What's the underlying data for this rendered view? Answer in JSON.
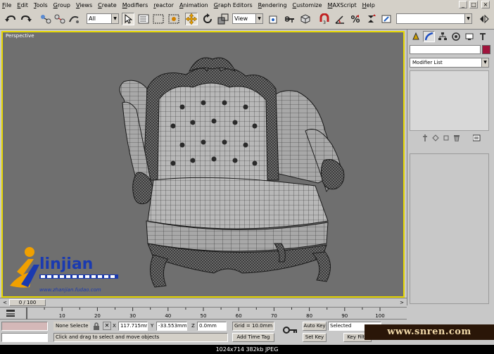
{
  "menu": [
    "File",
    "Edit",
    "Tools",
    "Group",
    "Views",
    "Create",
    "Modifiers",
    "reactor",
    "Animation",
    "Graph Editors",
    "Rendering",
    "Customize",
    "MAXScript",
    "Help"
  ],
  "window_controls": [
    "_",
    "□",
    "×"
  ],
  "toolbar": {
    "selection_filter": "All",
    "ref_coord": "View",
    "named_selection": ""
  },
  "viewport": {
    "label": "Perspective"
  },
  "command_panel": {
    "modifier_list": "Modifier List",
    "object_color": "#a0143c"
  },
  "time_slider": {
    "label": "0 / 100",
    "prev": "<",
    "next": ">"
  },
  "track": {
    "ticks": [
      "10",
      "20",
      "30",
      "40",
      "50",
      "60",
      "70",
      "80",
      "90",
      "100"
    ]
  },
  "status": {
    "selection": "None Selecte",
    "x_value": "117.715mm",
    "y_value": "-33.553mm",
    "z_value": "0.0mm",
    "x_label": "X",
    "y_label": "Y",
    "z_label": "Z",
    "grid": "Grid = 10.0mm",
    "prompt": "Click and drag to select and move objects",
    "add_time_tag": "Add Time Tag",
    "auto_key": "Auto Key",
    "set_key": "Set Key",
    "key_mode": "Selected",
    "key_filters": "Key Filte"
  },
  "watermark": {
    "logo_text": "linjian",
    "logo_url": "www.zhanjian.fudao.com",
    "site": "www.snren.com"
  },
  "image_info": "1024x714  382kb  JPEG",
  "colors": {
    "viewport_bg": "#6f6f6f",
    "viewport_border": "#e8d800",
    "panel_bg": "#c8c8c8"
  }
}
